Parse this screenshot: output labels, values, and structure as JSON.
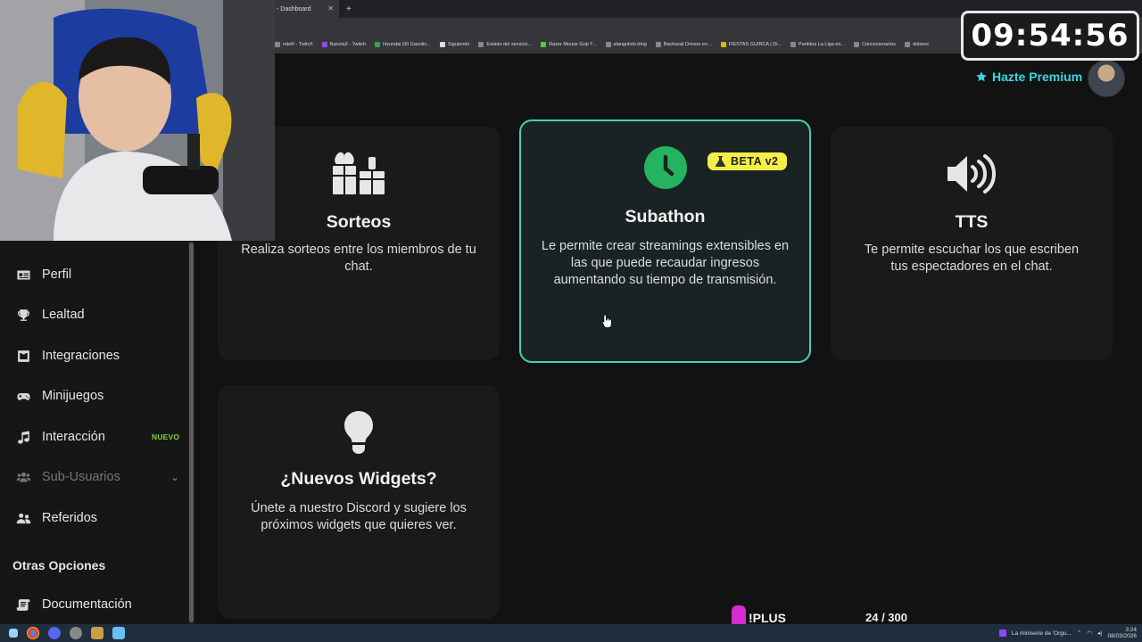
{
  "browser": {
    "tab_title": "- Dashboard",
    "bookmarks": [
      "ndeR - Twitch",
      "Nancla3 - Twitch",
      "Hyundai i30 Gasolin...",
      "Siguiendo",
      "Estado del servicio...",
      "Razer Mouse Grip T...",
      "alanguloto.blog",
      "Backseat Drivers en...",
      "FIESTAS GUIRCA | Di...",
      "Partidos La Liga en...",
      "Concesionarios",
      "dolares"
    ]
  },
  "header": {
    "premium_label": "Hazte Premium",
    "accent_color": "#39d7e0"
  },
  "overlay": {
    "timer": "09:54:56",
    "plus_label": "!PLUS",
    "counter": "24 / 300"
  },
  "sidebar": {
    "items": [
      {
        "label": "Perfil",
        "icon": "id-card-icon"
      },
      {
        "label": "Lealtad",
        "icon": "trophy-icon"
      },
      {
        "label": "Integraciones",
        "icon": "puzzle-box-icon"
      },
      {
        "label": "Minijuegos",
        "icon": "gamepad-icon"
      },
      {
        "label": "Interacción",
        "icon": "music-note-icon",
        "badge": "NUEVO"
      },
      {
        "label": "Sub-Usuarios",
        "icon": "users-icon"
      },
      {
        "label": "Referidos",
        "icon": "user-group-icon"
      }
    ],
    "section_heading": "Otras Opciones",
    "docs_label": "Documentación"
  },
  "cards": {
    "sorteos": {
      "title": "Sorteos",
      "desc": "Realiza sorteos entre los miembros de tu chat."
    },
    "subathon": {
      "title": "Subathon",
      "badge": "BETA v2",
      "desc": "Le permite crear streamings extensibles en las que puede recaudar ingresos aumentando su tiempo de transmisión."
    },
    "tts": {
      "title": "TTS",
      "desc": "Te permite escuchar los que escriben tus espectadores en el chat."
    },
    "widgets": {
      "title": "¿Nuevos Widgets?",
      "desc": "Únete a nuestro Discord y sugiere los próximos widgets que quieres ver."
    }
  },
  "taskbar": {
    "tray_text": "La miniserie de 'Orgu...",
    "time": "3:24",
    "date": "08/03/2026"
  }
}
